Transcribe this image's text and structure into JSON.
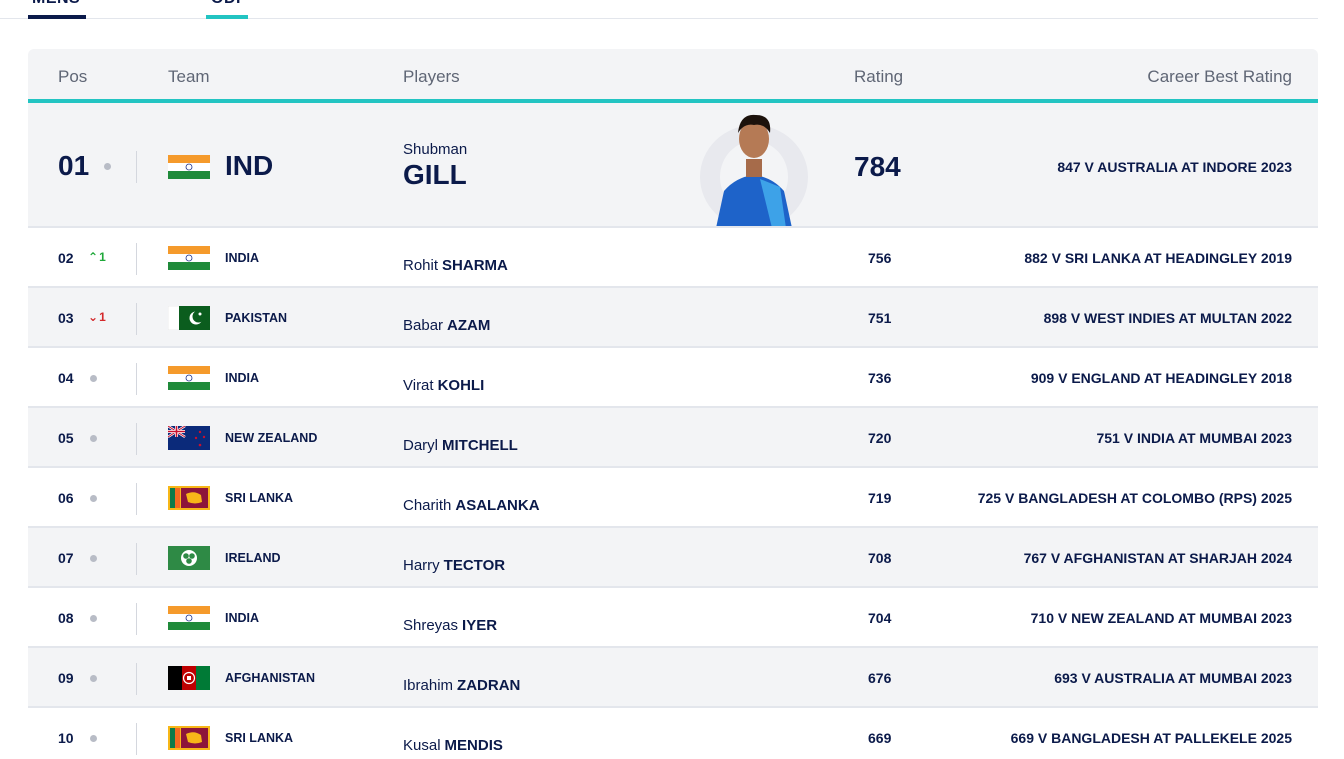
{
  "tabs": [
    {
      "label": "MENS"
    },
    {
      "label": "ODI"
    }
  ],
  "header": {
    "pos": "Pos",
    "team": "Team",
    "players": "Players",
    "rating": "Rating",
    "career_best": "Career Best Rating"
  },
  "top": {
    "pos": "01",
    "team_abbr": "IND",
    "flag": "india-flag",
    "first_name": "Shubman",
    "last_name": "GILL",
    "rating": "784",
    "career_best": "847 V AUSTRALIA AT INDORE 2023"
  },
  "rows": [
    {
      "pos": "02",
      "movement": "up",
      "change": "1",
      "team": "INDIA",
      "flag": "india-flag",
      "first": "Rohit",
      "last": "SHARMA",
      "rating": "756",
      "best": "882 V SRI LANKA AT HEADINGLEY 2019"
    },
    {
      "pos": "03",
      "movement": "down",
      "change": "1",
      "team": "PAKISTAN",
      "flag": "pakistan-flag",
      "first": "Babar",
      "last": "AZAM",
      "rating": "751",
      "best": "898 V WEST INDIES AT MULTAN 2022"
    },
    {
      "pos": "04",
      "movement": "none",
      "change": "",
      "team": "INDIA",
      "flag": "india-flag",
      "first": "Virat",
      "last": "KOHLI",
      "rating": "736",
      "best": "909 V ENGLAND AT HEADINGLEY 2018"
    },
    {
      "pos": "05",
      "movement": "none",
      "change": "",
      "team": "NEW ZEALAND",
      "flag": "new-zealand-flag",
      "first": "Daryl",
      "last": "MITCHELL",
      "rating": "720",
      "best": "751 V INDIA AT MUMBAI 2023"
    },
    {
      "pos": "06",
      "movement": "none",
      "change": "",
      "team": "SRI LANKA",
      "flag": "sri-lanka-flag",
      "first": "Charith",
      "last": "ASALANKA",
      "rating": "719",
      "best": "725 V BANGLADESH AT COLOMBO (RPS) 2025"
    },
    {
      "pos": "07",
      "movement": "none",
      "change": "",
      "team": "IRELAND",
      "flag": "ireland-cricket-flag",
      "first": "Harry",
      "last": "TECTOR",
      "rating": "708",
      "best": "767 V AFGHANISTAN AT SHARJAH 2024"
    },
    {
      "pos": "08",
      "movement": "none",
      "change": "",
      "team": "INDIA",
      "flag": "india-flag",
      "first": "Shreyas",
      "last": "IYER",
      "rating": "704",
      "best": "710 V NEW ZEALAND AT MUMBAI 2023"
    },
    {
      "pos": "09",
      "movement": "none",
      "change": "",
      "team": "AFGHANISTAN",
      "flag": "afghanistan-flag",
      "first": "Ibrahim",
      "last": "ZADRAN",
      "rating": "676",
      "best": "693 V AUSTRALIA AT MUMBAI 2023"
    },
    {
      "pos": "10",
      "movement": "none",
      "change": "",
      "team": "SRI LANKA",
      "flag": "sri-lanka-flag",
      "first": "Kusal",
      "last": "MENDIS",
      "rating": "669",
      "best": "669 V BANGLADESH AT PALLEKELE 2025"
    }
  ],
  "colors": {
    "accent": "#22c4c2",
    "navy": "#0b1a4a",
    "up": "#1fa83a",
    "down": "#d4282b"
  }
}
